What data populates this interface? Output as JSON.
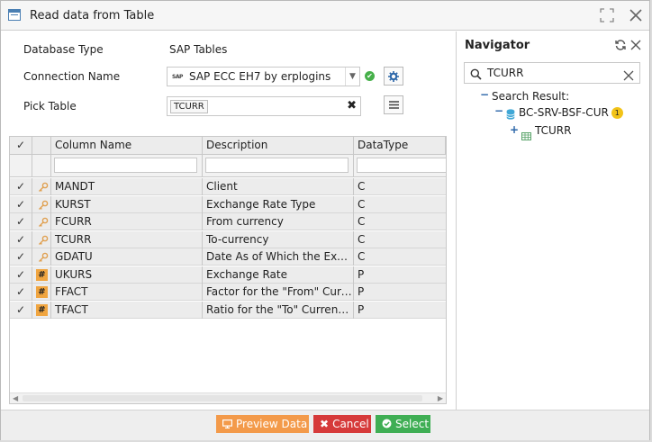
{
  "window": {
    "title": "Read data from Table"
  },
  "form": {
    "database_type_label": "Database Type",
    "database_type_value": "SAP Tables",
    "connection_name_label": "Connection Name",
    "connection_name_value": "SAP ECC EH7 by erplogins",
    "pick_table_label": "Pick Table",
    "pick_table_chip": "TCURR"
  },
  "grid": {
    "columns": {
      "check": "✓",
      "icon": "",
      "column_name": "Column Name",
      "description": "Description",
      "datatype": "DataType"
    },
    "rows": [
      {
        "checked": "✓",
        "icon": "key-icon",
        "name": "MANDT",
        "description": "Client",
        "datatype": "C"
      },
      {
        "checked": "✓",
        "icon": "key-icon",
        "name": "KURST",
        "description": "Exchange Rate Type",
        "datatype": "C"
      },
      {
        "checked": "✓",
        "icon": "key-icon",
        "name": "FCURR",
        "description": "From currency",
        "datatype": "C"
      },
      {
        "checked": "✓",
        "icon": "key-icon",
        "name": "TCURR",
        "description": "To-currency",
        "datatype": "C"
      },
      {
        "checked": "✓",
        "icon": "key-icon",
        "name": "GDATU",
        "description": "Date As of Which the Excha...",
        "datatype": "C"
      },
      {
        "checked": "✓",
        "icon": "hash-icon",
        "hash": "#",
        "name": "UKURS",
        "description": "Exchange Rate",
        "datatype": "P"
      },
      {
        "checked": "✓",
        "icon": "hash-icon",
        "hash": "#",
        "name": "FFACT",
        "description": "Factor for the \"From\" Curre...",
        "datatype": "P"
      },
      {
        "checked": "✓",
        "icon": "hash-icon",
        "hash": "#",
        "name": "TFACT",
        "description": "Ratio for the \"To\" Currency ...",
        "datatype": "P"
      }
    ]
  },
  "navigator": {
    "title": "Navigator",
    "search_value": "TCURR",
    "tree": {
      "root_label": "Search Result:",
      "group_label": "BC-SRV-BSF-CUR",
      "group_count": "1",
      "leaf_label": "TCURR"
    }
  },
  "footer": {
    "preview_label": "Preview Data",
    "cancel_label": "Cancel",
    "select_label": "Select"
  },
  "colors": {
    "preview": "#f39a4a",
    "cancel": "#d63a3a",
    "select": "#3fae54",
    "accent_blue": "#2a65a8"
  }
}
